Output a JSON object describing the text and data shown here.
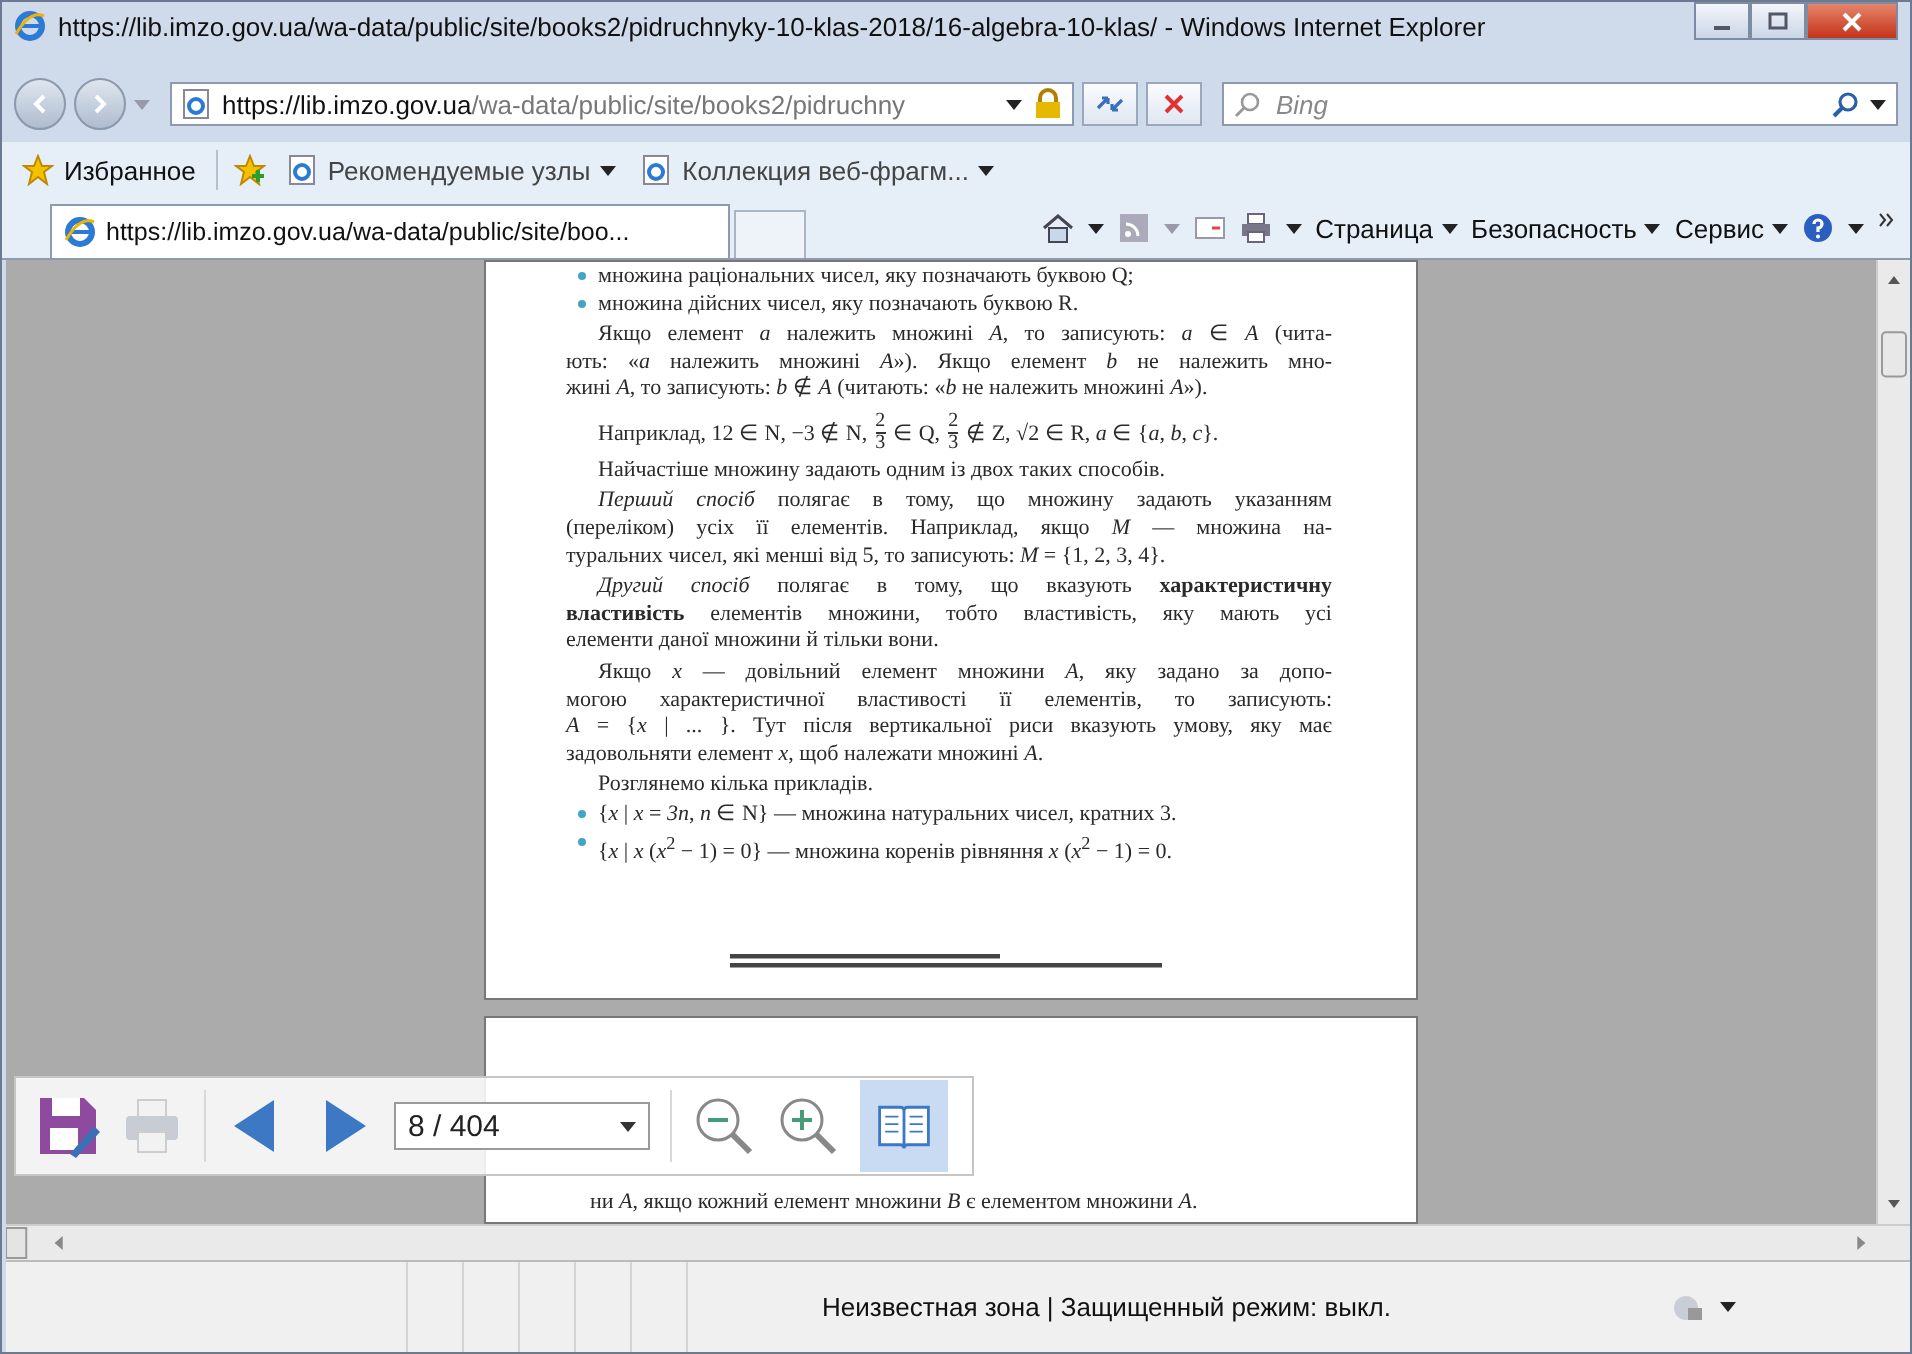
{
  "window": {
    "title": "https://lib.imzo.gov.ua/wa-data/public/site/books2/pidruchnyky-10-klas-2018/16-algebra-10-klas/ - Windows Internet Explorer"
  },
  "address_bar": {
    "host": "https://lib.imzo.gov.ua",
    "path": "/wa-data/public/site/books2/pidruchny"
  },
  "search": {
    "placeholder": "Bing"
  },
  "favorites_bar": {
    "favorites": "Избранное",
    "items": [
      "Рекомендуемые узлы",
      "Коллекция веб-фрагм..."
    ]
  },
  "tabs": [
    {
      "label": "https://lib.imzo.gov.ua/wa-data/public/site/boo...",
      "selected": true
    }
  ],
  "command_bar": [
    "Страница",
    "Безопасность",
    "Сервис"
  ],
  "page": {
    "blocks": [
      {
        "kind": "bullet",
        "lines": [
          "множина раціональних чисел, яку позначають буквою Q;"
        ]
      },
      {
        "kind": "bullet",
        "lines": [
          "множина дійсних чисел, яку позначають буквою R."
        ]
      },
      {
        "kind": "para",
        "lines": [
          "Якщо елемент *a* належить множині *A*, то записують: *a* ∈ *A* (чита-",
          "ють: «*a* належить множині *A*»). Якщо елемент *b* не належить мно-",
          "жині *A*, то записують: *b* ∉ *A* (читають: «*b* не належить множині *A*»)."
        ]
      },
      {
        "kind": "example",
        "segments": [
          {
            "kind": "text",
            "text": "Наприклад,  12 ∈ N,  −3 ∉ N,"
          },
          {
            "kind": "fraction",
            "num": "2",
            "den": "3"
          },
          {
            "kind": "text",
            "text": "∈ Q,"
          },
          {
            "kind": "fraction",
            "num": "2",
            "den": "3"
          },
          {
            "kind": "text",
            "text": "∉ Z,  √2 ∈ R,  *a* ∈ {*a*, *b*, *c*}."
          }
        ]
      },
      {
        "kind": "para",
        "lines": [
          "Найчастіше множину задають одним із двох таких способів."
        ]
      },
      {
        "kind": "para",
        "lines": [
          "*Перший спосіб* полягає в тому, що множину задають указанням",
          "(переліком) усіх її елементів. Наприклад, якщо *M* — множина на-",
          "туральних чисел, які менші від 5, то записують: *M* = {1, 2, 3, 4}."
        ]
      },
      {
        "kind": "para",
        "lines": [
          "*Другий спосіб* полягає в тому, що вказують **характеристичну**",
          "**властивість** елементів множини, тобто властивість, яку мають усі",
          "елементи даної множини й тільки вони."
        ]
      },
      {
        "kind": "para",
        "lines": [
          "Якщо *x* — довільний елемент множини *A*, яку задано за допо-",
          "могою характеристичної властивості її елементів, то записують:",
          "*A* = {*x* | ... }. Тут після вертикальної риси вказують умову, яку має",
          "задовольняти елемент *x*, щоб належати множині *A*."
        ]
      },
      {
        "kind": "para",
        "lines": [
          "Розглянемо кілька прикладів."
        ]
      },
      {
        "kind": "bullet",
        "lines": [
          "{*x* | *x* = *3n*, *n* ∈ N} — множина натуральних чисел, кратних 3."
        ]
      },
      {
        "kind": "bullet",
        "lines": [
          "{*x* | *x* (*x*$^{2}$ − 1) = 0} — множина коренів рівняння *x* (*x*$^{2}$ − 1) = 0."
        ]
      }
    ]
  },
  "next_page": {
    "lines": [
      "ни *A*, якщо кожний елемент множини *B* є елементом множини *A*."
    ]
  },
  "pdf_toolbar": {
    "page": "8 / 404",
    "book_view": {
      "selected": true
    }
  },
  "status_bar": {
    "text": "Неизвестная зона | Защищенный режим: выкл."
  }
}
